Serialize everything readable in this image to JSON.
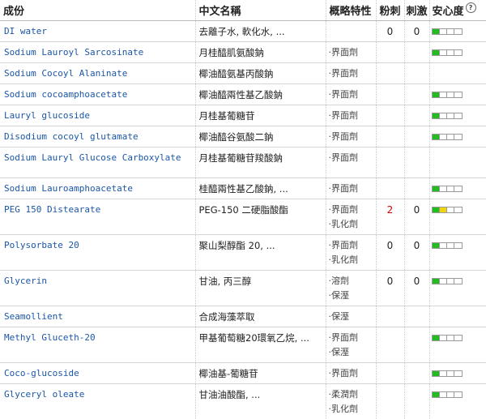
{
  "headers": {
    "name": "成份",
    "cn": "中文名稱",
    "feature": "概略特性",
    "acne": "粉刺",
    "irritant": "刺激",
    "safety": "安心度"
  },
  "colors": {
    "green": "#22bb22",
    "yellow": "#f2d400",
    "link": "#1a56a6",
    "red": "#d00000"
  },
  "rows": [
    {
      "name": "DI water",
      "cn": "去離子水, 軟化水, ...",
      "features": [],
      "acne": "0",
      "irritant": "0",
      "safety": {
        "level": 1,
        "color": "green"
      }
    },
    {
      "name": "Sodium Lauroyl Sarcosinate",
      "cn": "月桂醯肌氨酸鈉",
      "features": [
        "·界面劑"
      ],
      "acne": "",
      "irritant": "",
      "safety": {
        "level": 1,
        "color": "green"
      }
    },
    {
      "name": "Sodium Cocoyl Alaninate",
      "cn": "椰油醯氨基丙酸鈉",
      "features": [
        "·界面劑"
      ],
      "acne": "",
      "irritant": "",
      "safety": {
        "level": 0,
        "color": ""
      }
    },
    {
      "name": "Sodium cocoamphoacetate",
      "cn": "椰油醯兩性基乙酸鈉",
      "features": [
        "·界面劑"
      ],
      "acne": "",
      "irritant": "",
      "safety": {
        "level": 1,
        "color": "green"
      }
    },
    {
      "name": "Lauryl glucoside",
      "cn": "月桂基葡糖苷",
      "features": [
        "·界面劑"
      ],
      "acne": "",
      "irritant": "",
      "safety": {
        "level": 1,
        "color": "green"
      }
    },
    {
      "name": "Disodium cocoyl glutamate",
      "cn": "椰油醯谷氨酸二鈉",
      "features": [
        "·界面劑"
      ],
      "acne": "",
      "irritant": "",
      "safety": {
        "level": 1,
        "color": "green"
      }
    },
    {
      "name": "Sodium Lauryl Glucose Carboxylate",
      "cn": "月桂基葡糖苷羧酸鈉",
      "features": [
        "·界面劑"
      ],
      "acne": "",
      "irritant": "",
      "safety": {
        "level": 0,
        "color": ""
      }
    },
    {
      "name": "Sodium Lauroamphoacetate",
      "cn": "桂醯兩性基乙酸鈉, ...",
      "features": [
        "·界面劑"
      ],
      "acne": "",
      "irritant": "",
      "safety": {
        "level": 1,
        "color": "green"
      }
    },
    {
      "name": "PEG 150 Distearate",
      "cn": "PEG-150 二硬脂酸酯",
      "features": [
        "·界面劑",
        "·乳化劑"
      ],
      "acne": "2",
      "irritant": "0",
      "safety": {
        "level": 2,
        "color": "yellow"
      }
    },
    {
      "name": "Polysorbate 20",
      "cn": "聚山梨醇酯 20, ...",
      "features": [
        "·界面劑",
        "·乳化劑"
      ],
      "acne": "0",
      "irritant": "0",
      "safety": {
        "level": 1,
        "color": "green"
      }
    },
    {
      "name": "Glycerin",
      "cn": "甘油, 丙三醇",
      "features": [
        "·溶劑",
        "·保溼"
      ],
      "acne": "0",
      "irritant": "0",
      "safety": {
        "level": 1,
        "color": "green"
      }
    },
    {
      "name": "Seamollient",
      "cn": "合成海藻萃取",
      "features": [
        "·保溼"
      ],
      "acne": "",
      "irritant": "",
      "safety": {
        "level": 0,
        "color": ""
      }
    },
    {
      "name": "Methyl Gluceth-20",
      "cn": "甲基葡萄糖20環氧乙烷, ...",
      "features": [
        "·界面劑",
        "·保溼"
      ],
      "acne": "",
      "irritant": "",
      "safety": {
        "level": 1,
        "color": "green"
      }
    },
    {
      "name": "Coco-glucoside",
      "cn": "椰油基-葡糖苷",
      "features": [
        "·界面劑"
      ],
      "acne": "",
      "irritant": "",
      "safety": {
        "level": 1,
        "color": "green"
      }
    },
    {
      "name": "Glyceryl oleate",
      "cn": "甘油油酸酯, ...",
      "features": [
        "·柔潤劑",
        "·乳化劑"
      ],
      "acne": "",
      "irritant": "",
      "safety": {
        "level": 1,
        "color": "green"
      }
    }
  ]
}
